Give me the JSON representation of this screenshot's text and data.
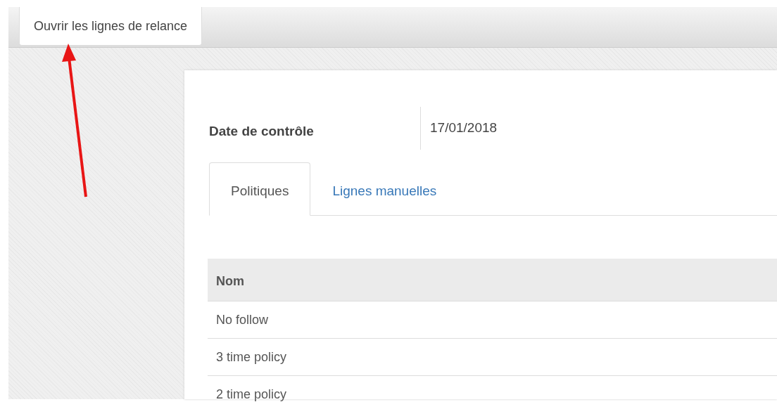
{
  "toolbar": {
    "button": "Ouvrir les lignes de relance"
  },
  "form": {
    "label": "Date de contrôle",
    "value": "17/01/2018"
  },
  "tabs": [
    {
      "label": "Politiques",
      "selected": true
    },
    {
      "label": "Lignes manuelles",
      "selected": false
    }
  ],
  "table": {
    "columns": [
      "Nom"
    ],
    "rows": [
      [
        "No follow"
      ],
      [
        "3 time policy"
      ],
      [
        "2 time policy"
      ]
    ]
  }
}
